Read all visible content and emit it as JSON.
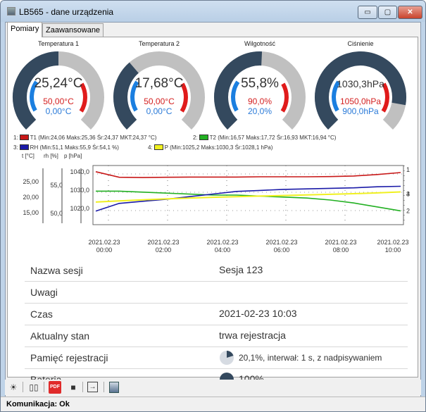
{
  "window": {
    "title": "LB565 - dane urządzenia",
    "min_label": "▭",
    "max_label": "▢",
    "close_label": "✕"
  },
  "tabs": [
    {
      "label": "Pomiary",
      "active": true
    },
    {
      "label": "Zaawansowane",
      "active": false
    }
  ],
  "gauges": [
    {
      "title": "Temperatura 1",
      "value": "25,24°C",
      "max": "50,00°C",
      "min": "0,00°C",
      "level": 0.5
    },
    {
      "title": "Temperatura 2",
      "value": "17,68°C",
      "max": "50,00°C",
      "min": "0,00°C",
      "level": 0.35
    },
    {
      "title": "Wilgotność",
      "value": "55,8%",
      "max": "90,0%",
      "min": "20,0%",
      "level": 0.51
    },
    {
      "title": "Ciśnienie",
      "value": "1030,3hPa",
      "max": "1050,0hPa",
      "min": "900,0hPa",
      "level": 0.87
    }
  ],
  "gauge_colors": {
    "fill": "#34495e",
    "track": "#c0c0c0",
    "red": "#e01b1b",
    "blue": "#1b7fe0"
  },
  "legend": [
    {
      "num": "1:",
      "text": "T1 (Min:24,06 Maks:25,36 Śr:24,37 MKT:24,37 °C)",
      "color": "#c81818"
    },
    {
      "num": "2:",
      "text": "T2 (Min:16,57 Maks:17,72 Śr:16,93 MKT:16,94 °C)",
      "color": "#22b022"
    },
    {
      "num": "3:",
      "text": "RH (Min:51,1 Maks:55,9 Śr:54,1 %)",
      "color": "#1a1aa8"
    },
    {
      "num": "4:",
      "text": "P (Min:1025,2 Maks:1030,3 Śr:1028,1 hPa)",
      "color": "#f0f020"
    }
  ],
  "chart_data": {
    "type": "line",
    "axis_heads": {
      "t": "t [°C]",
      "rh": "rh [%]",
      "p": "p [hPa]"
    },
    "t_ticks": [
      "25,00",
      "20,00",
      "15,00"
    ],
    "rh_ticks": [
      "55,0",
      "50,0"
    ],
    "p_ticks": [
      "1040,0",
      "1030,0",
      "1020,0"
    ],
    "x_labels": [
      {
        "date": "2021.02.23",
        "time": "00:00"
      },
      {
        "date": "2021.02.23",
        "time": "02:00"
      },
      {
        "date": "2021.02.23",
        "time": "04:00"
      },
      {
        "date": "2021.02.23",
        "time": "06:00"
      },
      {
        "date": "2021.02.23",
        "time": "08:00"
      },
      {
        "date": "2021.02.23",
        "time": "10:00"
      }
    ],
    "series": [
      {
        "name": "T1",
        "color": "#c81818",
        "y": [
          25.36,
          24.25,
          24.2,
          24.25,
          24.3,
          24.3,
          24.3,
          24.35,
          24.35,
          24.35,
          24.4,
          24.5,
          24.8,
          25.2
        ]
      },
      {
        "name": "T2",
        "color": "#22b022",
        "y": [
          16.6,
          16.6,
          16.65,
          16.7,
          16.75,
          16.8,
          16.8,
          16.85,
          16.9,
          16.95,
          17.05,
          17.2,
          17.4,
          17.6
        ]
      },
      {
        "name": "RH",
        "color": "#1a1aa8",
        "y": [
          51.1,
          52.6,
          53.0,
          53.4,
          53.9,
          54.4,
          54.9,
          55.1,
          55.3,
          55.4,
          55.5,
          55.6,
          55.8,
          55.9
        ]
      },
      {
        "name": "P",
        "color": "#f0f020",
        "y": [
          1025.2,
          1025.8,
          1026.3,
          1026.8,
          1027.2,
          1027.6,
          1027.9,
          1028.2,
          1028.5,
          1028.8,
          1029.1,
          1029.4,
          1029.8,
          1030.3
        ]
      }
    ],
    "end_labels": [
      "1",
      "4",
      "3",
      "2"
    ]
  },
  "info_rows": [
    {
      "label": "Nazwa sesji",
      "value": "Sesja 123"
    },
    {
      "label": "Uwagi",
      "value": ""
    },
    {
      "label": "Czas",
      "value": "2021-02-23 10:03"
    },
    {
      "label": "Aktualny stan",
      "value": "trwa rejestracja"
    },
    {
      "label": "Pamięć rejestracji",
      "value": "20,1%, interwał: 1 s, z nadpisywaniem",
      "memory_fraction": 0.201
    },
    {
      "label": "Bateria",
      "value": "100%",
      "battery_fraction": 1.0
    }
  ],
  "toolbar": [
    "settings-icon",
    "book-icon",
    "pdf-icon",
    "save-icon",
    "export-icon",
    "device-icon"
  ],
  "status": {
    "text": "Komunikacja: Ok"
  }
}
